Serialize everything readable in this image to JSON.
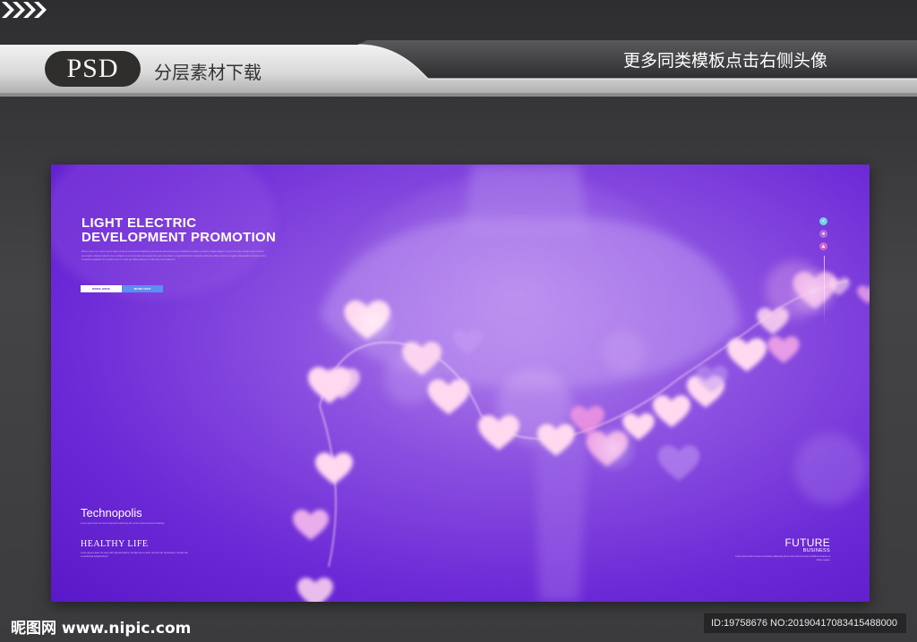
{
  "banner": {
    "badge": "PSD",
    "subtitle": "分层素材下载",
    "cta": "更多同类模板点击右侧头像"
  },
  "artwork": {
    "headline_line1": "LIGHT ELECTRIC",
    "headline_line2": "DEVELOPMENT PROMOTION",
    "body_text": "When poster ctr. Lorem ipsum dolor sit amet consectetur adipiscing elit sed do eiusmod tempor incididunt ut labore et dolore magna aliqua ut enim ad minim veniam quis nostrud exercitation ullamco laboris nisi ut aliquip ex ea commodo consequat duis aute irure dolor in reprehenderit in voluptate velit esse cillum dolore eu fugiat nulla pariatur excepteur sint occaecat cupidatat non proident sunt in culpa qui officia deserunt mollit anim id est laborum.",
    "button_primary": "MORE HERE",
    "button_secondary": "MORE INFO",
    "techno_title": "Technopolis",
    "techno_info": "Lorem ipsum dolor sit amet consectetur adipiscing elit sed do eiusmod tempor incididunt.",
    "healthy_title": "HEALTHY LIFE",
    "healthy_desc": "Lorem ipsum dolor sit amet with Signals Nature, the like line to stick, and the are Sometimes, include the a residential neighborhood.",
    "future_title": "FUTURE",
    "business_title": "BUSINESS",
    "future_desc": "Lorem ipsum dolor sit amet consectetur adipiscing elit sed do eiusmod tempor incididunt ut labore et dolore magna."
  },
  "footer": {
    "site": "昵图网 www.nipic.com",
    "id_text": "ID:19758676 NO:20190417083415488000"
  },
  "colors": {
    "art_base": "#6b28d6",
    "heart": "#ffd9f0",
    "button_blue": "#5b8ff0"
  }
}
